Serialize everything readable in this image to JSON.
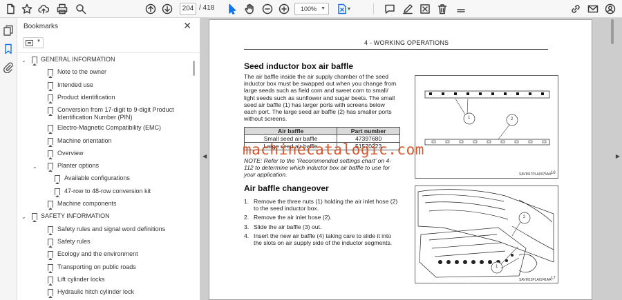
{
  "toolbar": {
    "current_page": "204",
    "total_pages": "/ 418",
    "zoom": "100%"
  },
  "panel": {
    "title": "Bookmarks",
    "close_glyph": "✕"
  },
  "bookmarks": [
    {
      "label": "GENERAL INFORMATION",
      "level": 0,
      "toggle": "v"
    },
    {
      "label": "Note to the owner",
      "level": 1
    },
    {
      "label": "Intended use",
      "level": 1
    },
    {
      "label": "Product identification",
      "level": 1
    },
    {
      "label": "Conversion from 17-digit to 9-digit Product Identification Number (PIN)",
      "level": 1
    },
    {
      "label": "Electro-Magnetic Compatibility (EMC)",
      "level": 1
    },
    {
      "label": "Machine orientation",
      "level": 1
    },
    {
      "label": "Overview",
      "level": 1
    },
    {
      "label": "Planter options",
      "level": 1,
      "toggle": "v"
    },
    {
      "label": "Available configurations",
      "level": 2
    },
    {
      "label": "47-row to 48-row conversion kit",
      "level": 2
    },
    {
      "label": "Machine components",
      "level": 1
    },
    {
      "label": "SAFETY INFORMATION",
      "level": 0,
      "toggle": "v"
    },
    {
      "label": "Safety rules and signal word definitions",
      "level": 1
    },
    {
      "label": "Safety rules",
      "level": 1
    },
    {
      "label": "Ecology and the environment",
      "level": 1
    },
    {
      "label": "Transporting on public roads",
      "level": 1
    },
    {
      "label": "Lift cylinder locks",
      "level": 1
    },
    {
      "label": "Hydraulic hitch cylinder lock",
      "level": 1
    }
  ],
  "document": {
    "header": "4 - WORKING OPERATIONS",
    "section1_title": "Seed inductor box air baffle",
    "section1_para": "The air baffle inside the air supply chamber of the seed inductor box must be swapped out when you change from large seeds such as field corn and sweet corn to small/ light seeds such as sunflower and sugar beets. The small seed air baffle (1) has larger ports with screens below each port. The large seed air baffle (2) has smaller ports without screens.",
    "table": {
      "headers": [
        "Air baffle",
        "Part number"
      ],
      "rows": [
        [
          "Small seed air baffle",
          "47397680"
        ],
        [
          "Large seed air baffle",
          "51570223"
        ]
      ]
    },
    "note": "NOTE: Refer to the ‘Recommended settings chart’ on 4-112 to determine which inductor box air baffle to use for your application.",
    "section2_title": "Air baffle changeover",
    "steps": [
      {
        "num": "1.",
        "text": "Remove the three nuts (1) holding the air inlet hose (2) to the seed inductor box."
      },
      {
        "num": "2.",
        "text": "Remove the air inlet hose (2)."
      },
      {
        "num": "3.",
        "text": "Slide the air baffle (3) out."
      },
      {
        "num": "4.",
        "text": "Insert the new air baffle (4) taking care to slide it into the slots on air supply side of the inductor segments."
      }
    ],
    "figure1": {
      "code": "SAVM17PLA0975AA",
      "number": "16",
      "callouts": [
        "1",
        "2"
      ]
    },
    "figure2": {
      "code": "SAVM13PLA0241AA",
      "number": "17",
      "callouts": [
        "1",
        "2"
      ]
    },
    "watermark": "machinecatalogic.com"
  },
  "colors": {
    "accent": "#1473e6",
    "watermark": "#d24b1f"
  }
}
